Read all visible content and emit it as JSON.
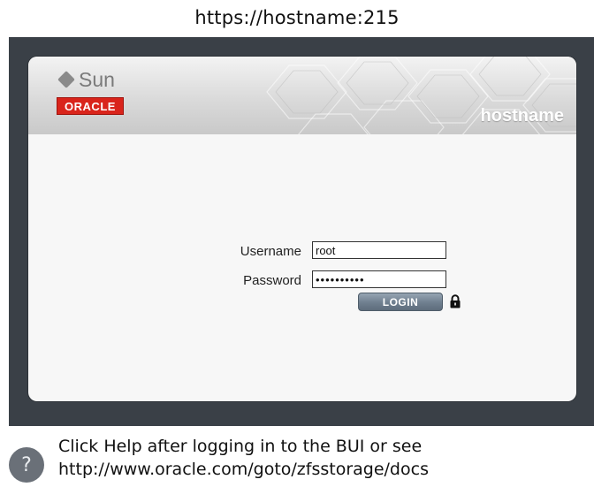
{
  "caption": {
    "url": "https://hostname:215"
  },
  "header": {
    "sun_logo_text": "Sun",
    "oracle_logo_text": "ORACLE",
    "hostname": "hostname"
  },
  "login_form": {
    "username_label": "Username",
    "username_value": "root",
    "password_label": "Password",
    "password_value": "••••••••••",
    "login_button_label": "LOGIN",
    "lock_icon": "lock-icon"
  },
  "help": {
    "icon_glyph": "?",
    "line1": "Click Help after logging in to the BUI or see",
    "line2": "http://www.oracle.com/goto/zfsstorage/docs"
  },
  "colors": {
    "frame_bg": "#3a4047",
    "oracle_red": "#d9241b",
    "login_button": "#6f7f8f",
    "help_icon_bg": "#6a7078"
  }
}
